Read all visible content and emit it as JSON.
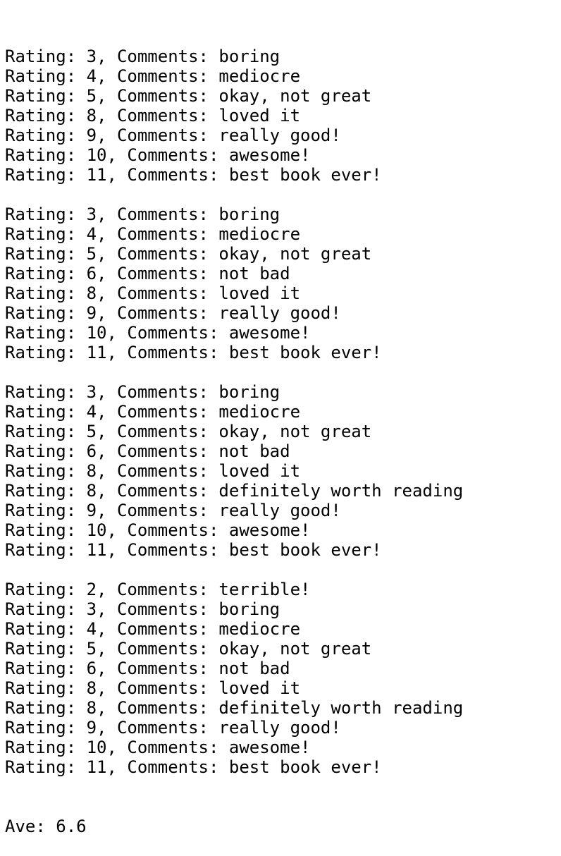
{
  "output": {
    "blocks": [
      {
        "lines": [
          "Rating: 3, Comments: boring",
          "Rating: 4, Comments: mediocre",
          "Rating: 5, Comments: okay, not great",
          "Rating: 8, Comments: loved it",
          "Rating: 9, Comments: really good!",
          "Rating: 10, Comments: awesome!",
          "Rating: 11, Comments: best book ever!"
        ]
      },
      {
        "lines": [
          "Rating: 3, Comments: boring",
          "Rating: 4, Comments: mediocre",
          "Rating: 5, Comments: okay, not great",
          "Rating: 6, Comments: not bad",
          "Rating: 8, Comments: loved it",
          "Rating: 9, Comments: really good!",
          "Rating: 10, Comments: awesome!",
          "Rating: 11, Comments: best book ever!"
        ]
      },
      {
        "lines": [
          "Rating: 3, Comments: boring",
          "Rating: 4, Comments: mediocre",
          "Rating: 5, Comments: okay, not great",
          "Rating: 6, Comments: not bad",
          "Rating: 8, Comments: loved it",
          "Rating: 8, Comments: definitely worth reading",
          "Rating: 9, Comments: really good!",
          "Rating: 10, Comments: awesome!",
          "Rating: 11, Comments: best book ever!"
        ]
      },
      {
        "lines": [
          "Rating: 2, Comments: terrible!",
          "Rating: 3, Comments: boring",
          "Rating: 4, Comments: mediocre",
          "Rating: 5, Comments: okay, not great",
          "Rating: 6, Comments: not bad",
          "Rating: 8, Comments: loved it",
          "Rating: 8, Comments: definitely worth reading",
          "Rating: 9, Comments: really good!",
          "Rating: 10, Comments: awesome!",
          "Rating: 11, Comments: best book ever!"
        ]
      }
    ],
    "average_line": "Ave: 6.6"
  }
}
